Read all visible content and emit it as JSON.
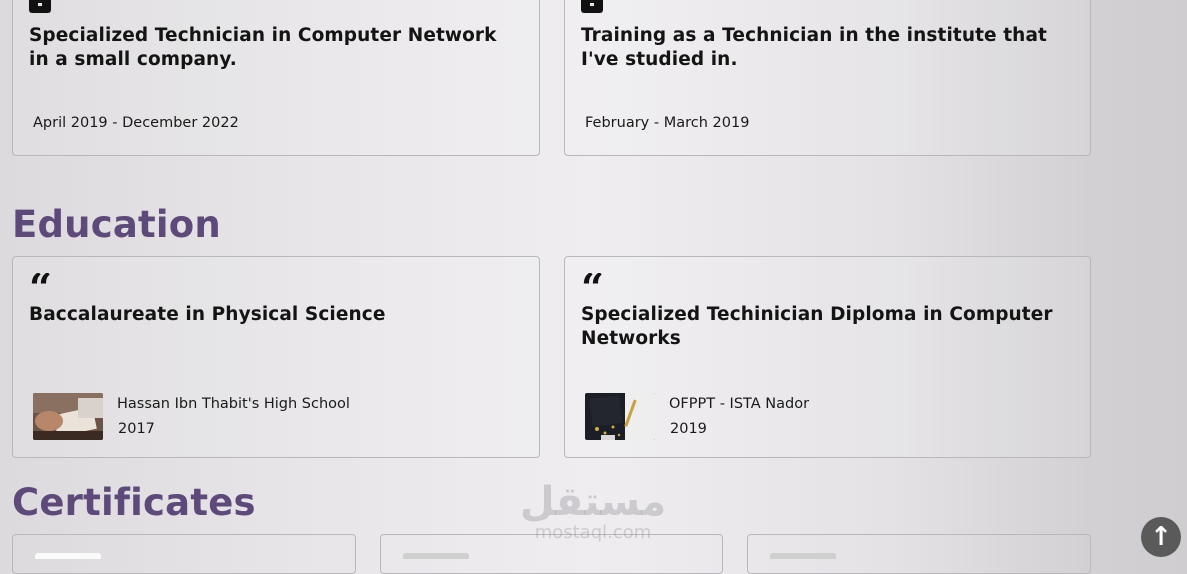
{
  "experience": [
    {
      "title": "Specialized Technician in Computer Network in a small company.",
      "date": "April 2019 - December 2022"
    },
    {
      "title": "Training as a Technician in the institute that I've studied in.",
      "date": "February - March 2019"
    }
  ],
  "education_heading": "Education",
  "education": [
    {
      "quote_icon": "“",
      "title": "Baccalaureate in Physical Science",
      "school": "Hassan Ibn Thabit's High School",
      "year": "2017"
    },
    {
      "quote_icon": "“",
      "title": "Specialized Techinician Diploma in Computer Networks",
      "school": "OFPPT - ISTA Nador",
      "year": "2019"
    }
  ],
  "certificates_heading": "Certificates",
  "watermark": {
    "arabic": "مستقل",
    "latin": "mostaql.com"
  },
  "scroll_top_icon": "↑",
  "colors": {
    "heading": "#5d4a7a",
    "card_border": "#b9b7bb",
    "scroll_button": "#5a5a5a"
  }
}
